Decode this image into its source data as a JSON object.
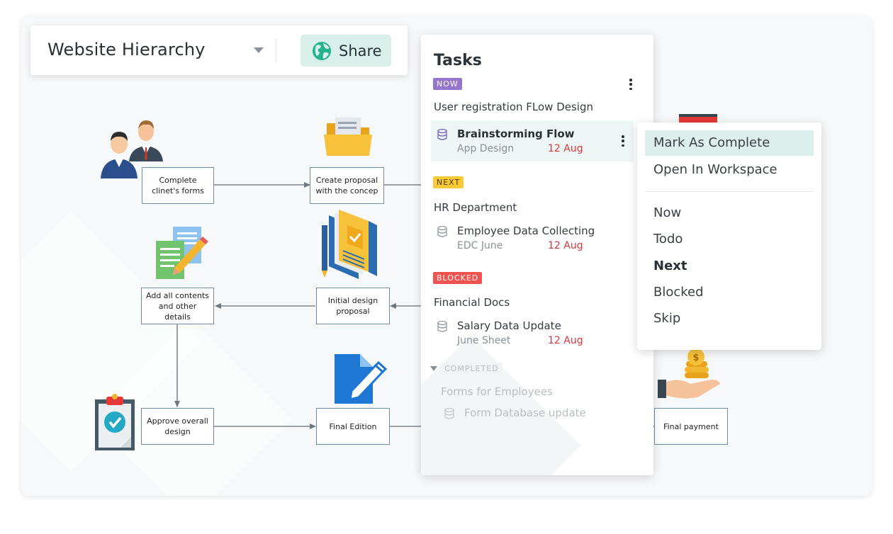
{
  "header": {
    "title": "Website Hierarchy",
    "share_label": "Share"
  },
  "diagram": {
    "nodes": {
      "complete_forms": "Complete\nclinet's forms",
      "create_proposal": "Create proposal\nwith the concep",
      "add_contents": "Add all contents\nand other details",
      "initial_design": "Initial design\nproposal",
      "approve_design": "Approve overall\ndesign",
      "final_edition": "Final Edition",
      "final_payment": "Final  payment"
    }
  },
  "tasks": {
    "title": "Tasks",
    "groups": [
      {
        "status": "NOW",
        "title": "User registration FLow Design",
        "items": [
          {
            "name": "Brainstorming Flow",
            "sub": "App Design",
            "date": "12 Aug"
          }
        ]
      },
      {
        "status": "NEXT",
        "title": "HR Department",
        "items": [
          {
            "name": "Employee Data Collecting",
            "sub": "EDC June",
            "date": "12 Aug"
          }
        ]
      },
      {
        "status": "BLOCKED",
        "title": "Financial Docs",
        "items": [
          {
            "name": "Salary Data Update",
            "sub": "June Sheet",
            "date": "12 Aug"
          }
        ]
      },
      {
        "status": "COMPLETED",
        "title": "Forms for Employees",
        "items": [
          {
            "name": "Form Database update"
          }
        ]
      }
    ]
  },
  "context_menu": {
    "actions": [
      "Mark As Complete",
      "Open In Workspace"
    ],
    "statuses": [
      "Now",
      "Todo",
      "Next",
      "Blocked",
      "Skip"
    ],
    "highlighted": "Mark As Complete",
    "current_status": "Next"
  },
  "colors": {
    "accent": "#d9efe9",
    "now_badge": "#9575cd",
    "next_badge": "#fcc937",
    "blocked_badge": "#ef5350",
    "date": "#d8373a",
    "node_border": "#6c8ca8"
  },
  "icons": [
    "globe-icon",
    "caret-down-icon",
    "kebab-menu-icon",
    "database-icon",
    "users-illustration",
    "folder-illustration",
    "document-pencil-illustration",
    "books-illustration",
    "clipboard-check-illustration",
    "edit-document-icon",
    "money-hand-illustration"
  ]
}
